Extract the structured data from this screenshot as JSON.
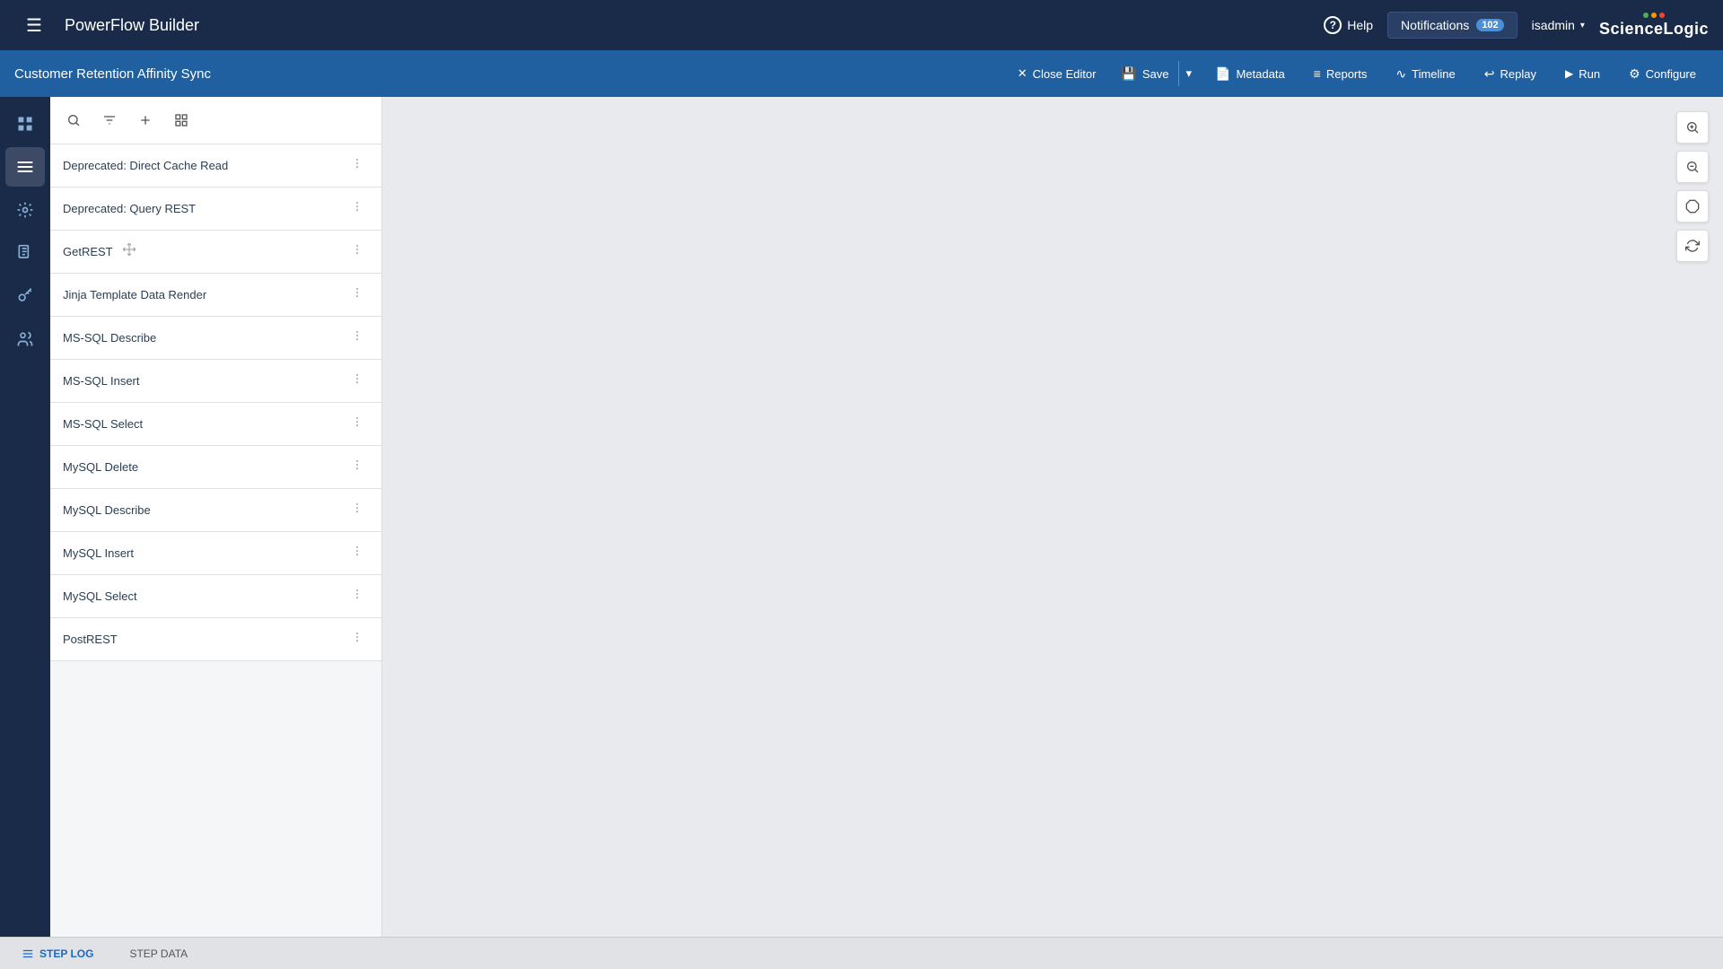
{
  "app": {
    "title": "PowerFlow Builder"
  },
  "topnav": {
    "help_label": "Help",
    "notifications_label": "Notifications",
    "notifications_count": "102",
    "user_label": "isadmin",
    "logo_text": "ScienceLogic"
  },
  "editor_toolbar": {
    "title": "Customer Retention Affinity Sync",
    "close_editor": "Close Editor",
    "save": "Save",
    "metadata": "Metadata",
    "reports": "Reports",
    "timeline": "Timeline",
    "replay": "Replay",
    "run": "Run",
    "configure": "Configure"
  },
  "steps": [
    {
      "name": "Deprecated: Direct Cache Read"
    },
    {
      "name": "Deprecated: Query REST"
    },
    {
      "name": "GetREST"
    },
    {
      "name": "Jinja Template Data Render"
    },
    {
      "name": "MS-SQL Describe"
    },
    {
      "name": "MS-SQL Insert"
    },
    {
      "name": "MS-SQL Select"
    },
    {
      "name": "MySQL Delete"
    },
    {
      "name": "MySQL Describe"
    },
    {
      "name": "MySQL Insert"
    },
    {
      "name": "MySQL Select"
    },
    {
      "name": "PostREST"
    }
  ],
  "bottom_tabs": [
    {
      "label": "STEP LOG",
      "active": true
    },
    {
      "label": "STEP DATA",
      "active": false
    }
  ],
  "icons": {
    "hamburger": "☰",
    "help_circle": "?",
    "chevron_down": "▾",
    "close": "✕",
    "save": "💾",
    "metadata": "📄",
    "reports": "≡",
    "timeline": "∿",
    "replay": "↩",
    "run": "▶",
    "configure": "⚙",
    "search": "🔍",
    "filter": "≡",
    "add": "+",
    "grid": "⊞",
    "more_vert": "⋮",
    "move": "✦",
    "zoom_in": "+",
    "zoom_out": "−",
    "octagon": "⬡",
    "refresh": "↻",
    "dashboard": "⊞",
    "user": "👤",
    "reports_side": "📊",
    "key": "🔑",
    "team": "👥",
    "step_log_icon": "≡"
  }
}
